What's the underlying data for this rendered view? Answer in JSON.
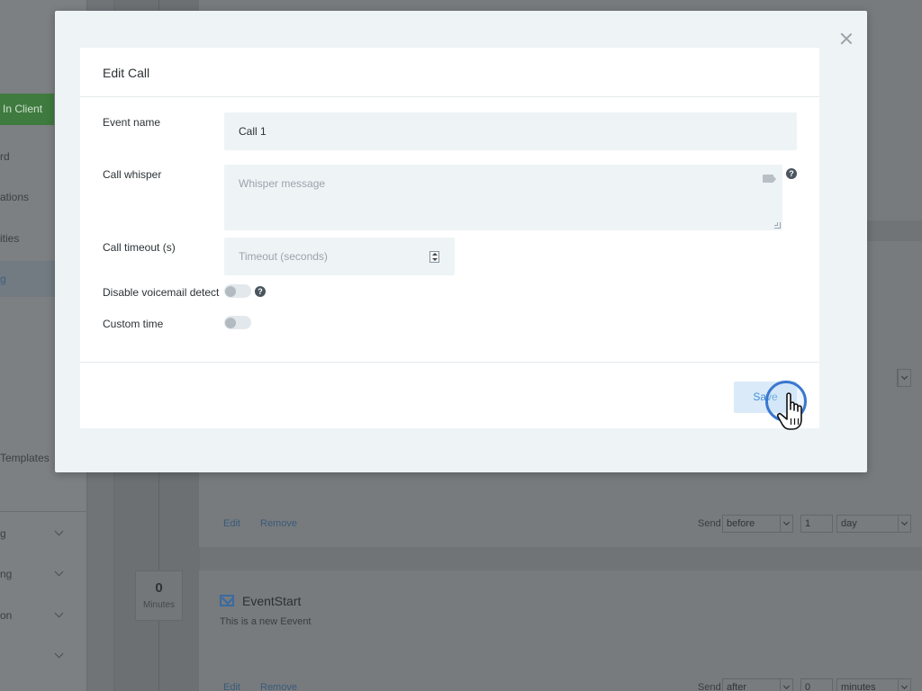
{
  "background": {
    "client_button": "In Client",
    "nav_items": [
      "rd",
      "ations",
      "ities",
      "g",
      "Templates"
    ],
    "collapsible_nav": [
      "g",
      "ng",
      "on",
      ""
    ],
    "rows": [
      {
        "edit": "Edit",
        "remove": "Remove",
        "send": "Send",
        "relation": "before",
        "amount": "1",
        "unit": "day"
      },
      {
        "edit": "Edit",
        "remove": "Remove",
        "send": "Send",
        "relation": "after",
        "amount": "0",
        "unit": "minutes"
      }
    ],
    "timeline_box": {
      "value": "0",
      "unit": "Minutes"
    },
    "event": {
      "title": "EventStart",
      "description": "This is a new Eevent"
    }
  },
  "modal": {
    "title": "Edit Call",
    "fields": {
      "event_name": {
        "label": "Event name",
        "value": "Call 1"
      },
      "call_whisper": {
        "label": "Call whisper",
        "placeholder": "Whisper message"
      },
      "call_timeout": {
        "label": "Call timeout (s)",
        "placeholder": "Timeout (seconds)"
      },
      "disable_voicemail": {
        "label": "Disable voicemail detect",
        "enabled": false
      },
      "custom_time": {
        "label": "Custom time",
        "enabled": false
      }
    },
    "save_label": "Save",
    "help_glyph": "?"
  },
  "colors": {
    "accent": "#3f8fd6",
    "overlay": "#6e7275",
    "client_button": "#3f7a3f"
  },
  "icons": [
    "close-icon",
    "tag-icon",
    "help-icon",
    "stepper-icon",
    "mail-icon",
    "hand-cursor-icon"
  ]
}
